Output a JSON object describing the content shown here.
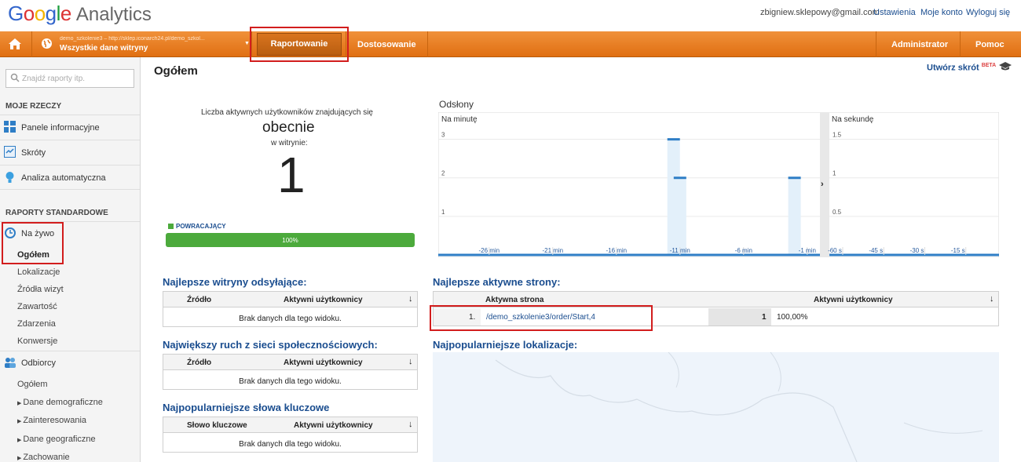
{
  "header": {
    "logo_google": "Google",
    "logo_analytics": "Analytics",
    "email": "zbigniew.sklepowy@gmail.com",
    "settings": "Ustawienia",
    "account": "Moje konto",
    "logout": "Wyloguj się"
  },
  "navbar": {
    "site_url": "demo_szkolenie3 – http://sklep.iconarch24.pl/demo_szkol...",
    "site_name": "Wszystkie dane witryny",
    "reports": "Raportowanie",
    "customize": "Dostosowanie",
    "admin": "Administrator",
    "help": "Pomoc"
  },
  "sidebar": {
    "search_placeholder": "Znajdź raporty itp.",
    "my_stuff_title": "MOJE RZECZY",
    "dashboards": "Panele informacyjne",
    "shortcuts": "Skróty",
    "intelligence": "Analiza automatyczna",
    "standard_title": "RAPORTY STANDARDOWE",
    "realtime": "Na żywo",
    "overview": "Ogółem",
    "locations": "Lokalizacje",
    "traffic_sources": "Źródła wizyt",
    "content": "Zawartość",
    "events": "Zdarzenia",
    "conversions": "Konwersje",
    "audience": "Odbiorcy",
    "audience_overview": "Ogółem",
    "demographics": "Dane demograficzne",
    "interests": "Zainteresowania",
    "geo": "Dane geograficzne",
    "behavior": "Zachowanie"
  },
  "main": {
    "title": "Ogółem",
    "create_shortcut": "Utwórz skrót",
    "beta": "BETA",
    "active_users_line1": "Liczba aktywnych użytkowników znajdujących się",
    "active_users_line2": "obecnie",
    "active_users_line3": "w witrynie:",
    "active_count": "1",
    "returning_label": "POWRACAJĄCY",
    "returning_pct": "100%",
    "returning_fraction": 1.0,
    "pageviews_title": "Odsłony",
    "per_minute": "Na minutę",
    "per_second": "Na sekundę"
  },
  "chart_data": [
    {
      "type": "bar",
      "title": "Na minutę",
      "x_ticks": [
        "-26 min",
        "-21 min",
        "-16 min",
        "-11 min",
        "-6 min",
        "-1 min"
      ],
      "y_ticks": [
        "1",
        "2",
        "3"
      ],
      "ylim": [
        0,
        3.5
      ],
      "bars": [
        {
          "minute": -11.5,
          "value": 3
        },
        {
          "minute": -11,
          "value": 2
        },
        {
          "minute": -2,
          "value": 2
        }
      ]
    },
    {
      "type": "bar",
      "title": "Na sekundę",
      "x_ticks": [
        "-60 s",
        "-45 s",
        "-30 s",
        "-15 s"
      ],
      "y_ticks": [
        "0.5",
        "1",
        "1.5"
      ],
      "ylim": [
        0,
        1.75
      ],
      "bars": []
    }
  ],
  "tables": {
    "referrals": {
      "title": "Najlepsze witryny odsyłające:",
      "col1": "Źródło",
      "col2": "Aktywni użytkownicy",
      "empty": "Brak danych dla tego widoku."
    },
    "social": {
      "title": "Największy ruch z sieci społecznościowych:",
      "col1": "Źródło",
      "col2": "Aktywni użytkownicy",
      "empty": "Brak danych dla tego widoku."
    },
    "keywords": {
      "title": "Najpopularniejsze słowa kluczowe",
      "col1": "Słowo kluczowe",
      "col2": "Aktywni użytkownicy",
      "empty": "Brak danych dla tego widoku."
    },
    "pages": {
      "title": "Najlepsze aktywne strony:",
      "col1": "Aktywna strona",
      "col2": "Aktywni użytkownicy",
      "rows": [
        {
          "rank": "1.",
          "page": "/demo_szkolenie3/order/Start,4",
          "users": "1",
          "pct": "100,00%"
        }
      ]
    },
    "locations": {
      "title": "Najpopularniejsze lokalizacje:"
    }
  },
  "colors": {
    "accent_orange": "#e8801f",
    "link_blue": "#1a4d8f",
    "bar_green": "#4caa3c",
    "chart_blue": "#2f7ec6",
    "highlight_red": "#d21d1d"
  }
}
